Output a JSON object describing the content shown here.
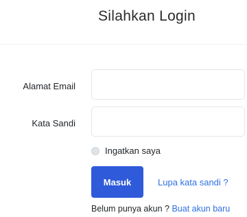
{
  "header": {
    "title": "Silahkan Login"
  },
  "form": {
    "email_label": "Alamat Email",
    "email_value": "",
    "password_label": "Kata Sandi",
    "password_value": "",
    "remember_label": "Ingatkan saya",
    "submit_label": "Masuk",
    "forgot_label": "Lupa kata sandi ?",
    "signup_prompt": "Belum punya akun ?",
    "signup_link": "Buat akun baru"
  },
  "colors": {
    "primary": "#2f5ad9",
    "link": "#2f6fe0"
  }
}
